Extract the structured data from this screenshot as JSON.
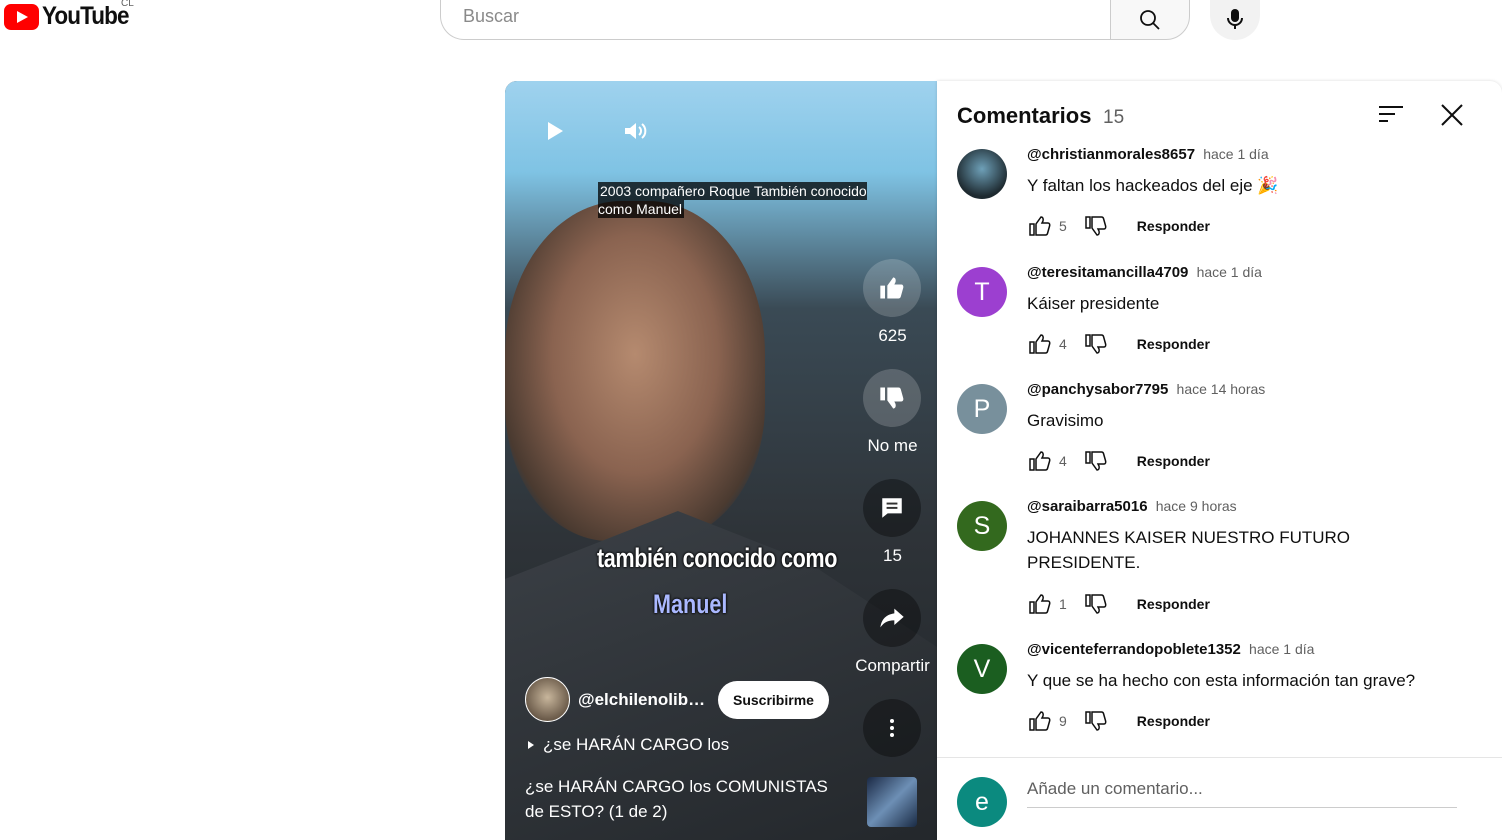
{
  "header": {
    "logo_text": "YouTube",
    "country": "CL",
    "search_placeholder": "Buscar"
  },
  "video": {
    "caption": "2003 compañero Roque También conocido como Manuel",
    "subtitle_line1": "también conocido como",
    "subtitle_line2": "Manuel",
    "likes": "625",
    "dislike_label": "No me",
    "comments_count": "15",
    "share_label": "Compartir",
    "channel_name": "@elchilenolibe...",
    "subscribe_label": "Suscribirme",
    "playlist_label": "¿se HARÁN CARGO los",
    "title": "¿se HARÁN CARGO los COMUNISTAS de ESTO? (1 de 2)"
  },
  "comments_panel": {
    "title": "Comentarios",
    "count": "15",
    "reply_label": "Responder",
    "add_placeholder": "Añade un comentario...",
    "user_initial": "e",
    "items": [
      {
        "author": "@christianmorales8657",
        "time": "hace 1 día",
        "text": "Y faltan los hackeados del eje 🎉",
        "likes": "5",
        "initial": "",
        "color": "#1e2a30"
      },
      {
        "author": "@teresitamancilla4709",
        "time": "hace 1 día",
        "text": "Káiser presidente",
        "likes": "4",
        "initial": "T",
        "color": "#9c3fd0"
      },
      {
        "author": "@panchysabor7795",
        "time": "hace 14 horas",
        "text": "Gravisimo",
        "likes": "4",
        "initial": "P",
        "color": "#78909c"
      },
      {
        "author": "@saraibarra5016",
        "time": "hace 9 horas",
        "text": "JOHANNES KAISER NUESTRO FUTURO PRESIDENTE.",
        "likes": "1",
        "initial": "S",
        "color": "#33691e"
      },
      {
        "author": "@vicenteferrandopoblete1352",
        "time": "hace 1 día",
        "text": "Y que se ha hecho con esta información tan grave?",
        "likes": "9",
        "initial": "V",
        "color": "#1b5e20"
      }
    ]
  }
}
